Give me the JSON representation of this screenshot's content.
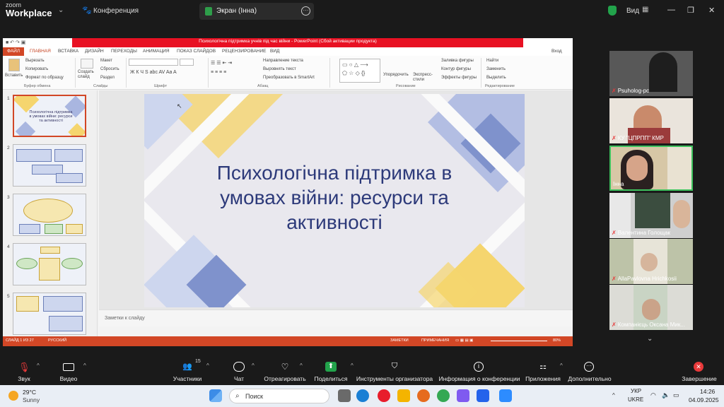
{
  "zoom": {
    "logo_top": "zoom",
    "logo_bottom": "Workplace",
    "menu": "Конференция",
    "share_tab": "Экран (Інна)",
    "view_label": "Вид"
  },
  "ppt": {
    "window_title": "Психологічна підтримка учнів під час війни - PowerPoint (Сбой активации продукта)",
    "file_tab": "ФАЙЛ",
    "tabs": [
      "ГЛАВНАЯ",
      "ВСТАВКА",
      "ДИЗАЙН",
      "ПЕРЕХОДЫ",
      "АНИМАЦИЯ",
      "ПОКАЗ СЛАЙДОВ",
      "РЕЦЕНЗИРОВАНИЕ",
      "ВИД"
    ],
    "signin": "Вход",
    "ribbon": {
      "paste": "Вставить",
      "cut": "Вырезать",
      "copy": "Копировать",
      "format_painter": "Формат по образцу",
      "new_slide": "Создать слайд",
      "layout": "Макет",
      "reset": "Сбросить",
      "section": "Раздел",
      "text_direction": "Направление текста",
      "align_text": "Выровнять текст",
      "smartart": "Преобразовать в SmartArt",
      "arrange": "Упорядочить",
      "quick_styles": "Экспресс-стили",
      "shape_fill": "Заливка фигуры",
      "shape_outline": "Контур фигуры",
      "shape_effects": "Эффекты фигуры",
      "find": "Найти",
      "replace": "Заменить",
      "select": "Выделить",
      "groups": [
        "Буфер обмена",
        "Слайды",
        "Шрифт",
        "Абзац",
        "Рисование",
        "Редактирование"
      ]
    },
    "thumbs": [
      {
        "num": "1",
        "text": "Психологічна підтримка в умовах війни: ресурси та активності"
      },
      {
        "num": "2"
      },
      {
        "num": "3"
      },
      {
        "num": "4"
      },
      {
        "num": "5"
      }
    ],
    "slide_title": "Психологічна підтримка в умовах війни: ресурси та активності",
    "notes_placeholder": "Заметки к слайду",
    "status": {
      "slide_info": "СЛАЙД 1 ИЗ 27",
      "language": "РУССКИЙ",
      "notes": "ЗАМЕТКИ",
      "comments": "ПРИМЕЧАНИЯ",
      "zoom": "80%"
    }
  },
  "participants": [
    {
      "name": "Psuholog-pc"
    },
    {
      "name": "КУ \"ЦПРПП\" КМР"
    },
    {
      "name": "Інна"
    },
    {
      "name": "Валентина Голощак"
    },
    {
      "name": "AllaPavlovna Hrichkosii"
    },
    {
      "name": "Компанієць Оксана Мик..."
    }
  ],
  "toolbar": {
    "audio": "Звук",
    "video": "Видео",
    "participants": "Участники",
    "participants_count": "15",
    "chat": "Чат",
    "react": "Отреагировать",
    "share": "Поделиться",
    "host_tools": "Инструменты организатора",
    "meeting_info": "Информация о конференции",
    "apps": "Приложения",
    "more": "Дополнительно",
    "end": "Завершение"
  },
  "taskbar": {
    "weather_temp": "29°C",
    "weather_desc": "Sunny",
    "search": "Поиск",
    "lang1": "УКР",
    "lang2": "UKRE",
    "time": "14:26",
    "date": "04.09.2025"
  },
  "colors": {
    "ppt_red": "#d24726",
    "slide_title": "#2d3a7a",
    "diamond_yellow": "#f5d56e",
    "diamond_blue": "#8898cc",
    "zoom_green": "#3ec25e",
    "end_red": "#e8393a"
  }
}
